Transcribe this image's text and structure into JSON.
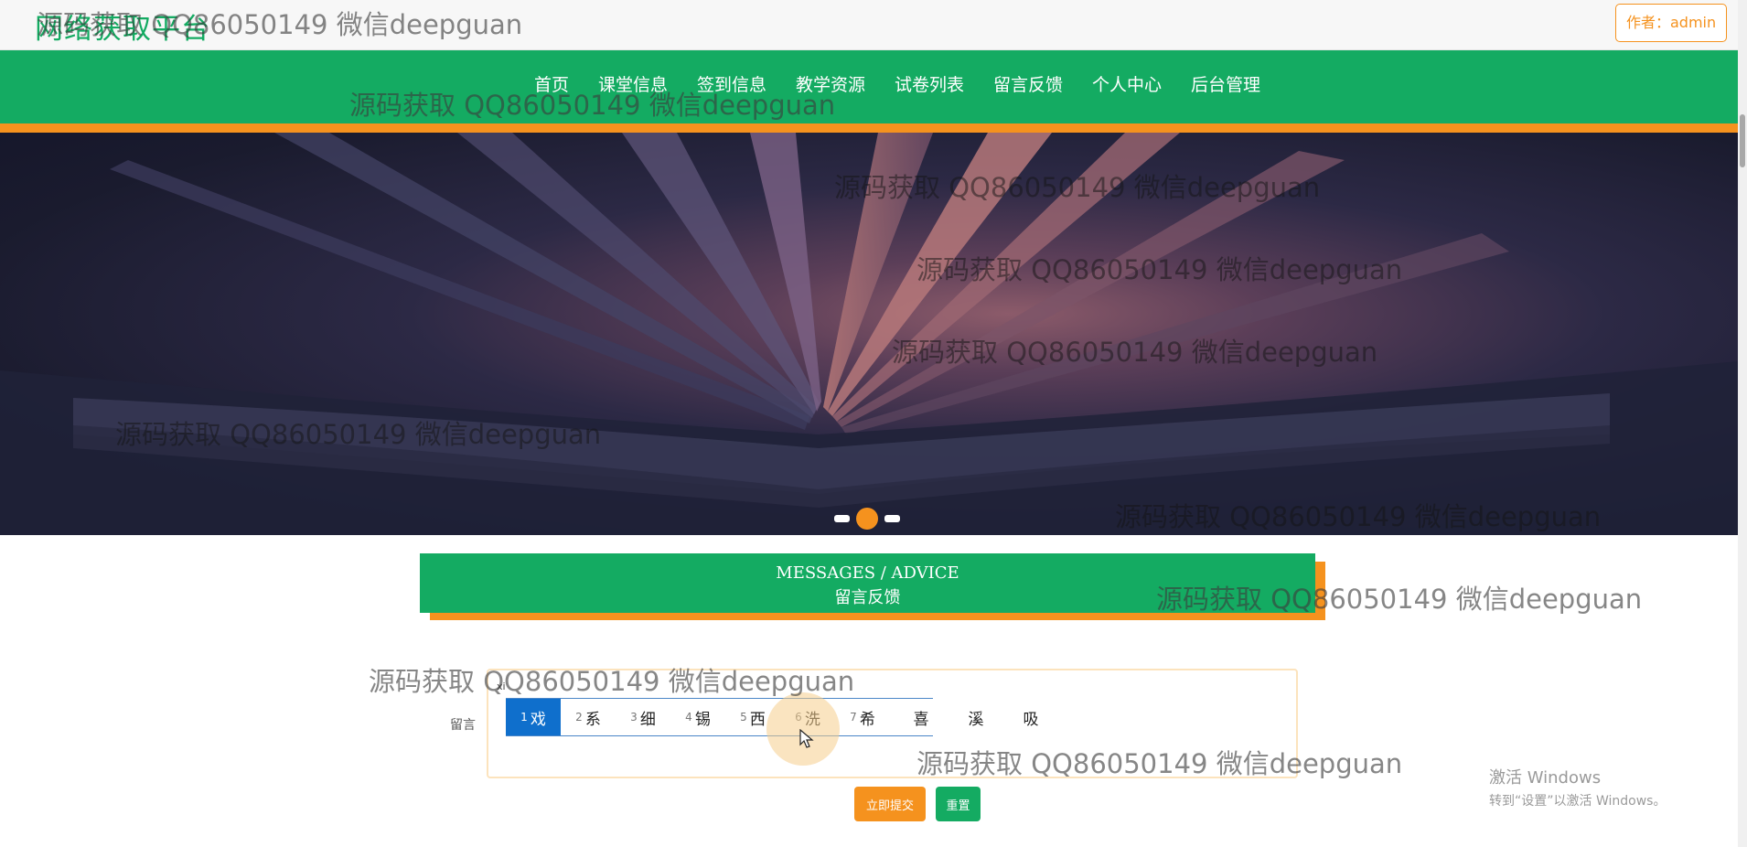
{
  "header": {
    "site_title": "网络获取平台",
    "author_button": "作者：admin"
  },
  "nav": {
    "items": [
      "首页",
      "课堂信息",
      "签到信息",
      "教学资源",
      "试卷列表",
      "留言反馈",
      "个人中心",
      "后台管理"
    ]
  },
  "banner": {
    "slide_count": 3,
    "active_slide": 2
  },
  "section": {
    "title_en": "MESSAGES / ADVICE",
    "title_cn": "留言反馈"
  },
  "form": {
    "message_label": "留言",
    "message_value": "",
    "submit_label": "立即提交",
    "reset_label": "重置"
  },
  "ime": {
    "composition": "xi",
    "candidates": [
      {
        "num": "1",
        "char": "戏"
      },
      {
        "num": "2",
        "char": "系"
      },
      {
        "num": "3",
        "char": "细"
      },
      {
        "num": "4",
        "char": "锡"
      },
      {
        "num": "5",
        "char": "西"
      },
      {
        "num": "6",
        "char": "洗"
      },
      {
        "num": "7",
        "char": "希"
      }
    ],
    "extra_candidates": [
      "喜",
      "溪",
      "吸"
    ]
  },
  "watermark": "源码获取 QQ86050149 微信deepguan",
  "windows_activation": {
    "title": "激活 Windows",
    "subtitle": "转到“设置”以激活 Windows。"
  },
  "colors": {
    "primary_green": "#14ab62",
    "accent_orange": "#f5921e",
    "ime_selected": "#0f6fcc"
  }
}
